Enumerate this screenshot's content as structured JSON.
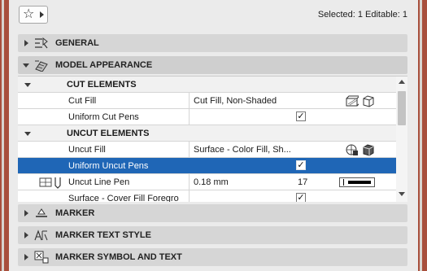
{
  "toolbar": {
    "favorites_icon": "star-icon",
    "selection_status": "Selected: 1 Editable: 1"
  },
  "sections": [
    {
      "title": "GENERAL",
      "icon": "general-settings-icon",
      "expanded": false
    },
    {
      "title": "MODEL APPEARANCE",
      "icon": "model-appearance-icon",
      "expanded": true
    },
    {
      "title": "MARKER",
      "icon": "marker-icon",
      "expanded": false
    },
    {
      "title": "MARKER TEXT STYLE",
      "icon": "marker-text-style-icon",
      "expanded": false
    },
    {
      "title": "MARKER SYMBOL AND TEXT",
      "icon": "marker-symbol-icon",
      "expanded": false
    }
  ],
  "model_appearance": {
    "cut_group": "CUT ELEMENTS",
    "cut_fill_label": "Cut Fill",
    "cut_fill_value": "Cut Fill, Non-Shaded",
    "uniform_cut_pens_label": "Uniform Cut Pens",
    "uniform_cut_pens_checked": true,
    "uncut_group": "UNCUT ELEMENTS",
    "uncut_fill_label": "Uncut Fill",
    "uncut_fill_value": "Surface - Color Fill, Sh...",
    "uniform_uncut_pens_label": "Uniform Uncut Pens",
    "uniform_uncut_pens_checked": true,
    "uncut_line_pen_label": "Uncut Line Pen",
    "uncut_line_pen_value": "0.18 mm",
    "uncut_line_pen_number": "17",
    "partial_row_label": "Surface - Cover Fill Foregro",
    "partial_row_checked": true
  },
  "colors": {
    "selection": "#1f66b6",
    "panel": "#ebebeb",
    "section_header": "#d6d6d6",
    "background_wall": "#a84f3c"
  }
}
